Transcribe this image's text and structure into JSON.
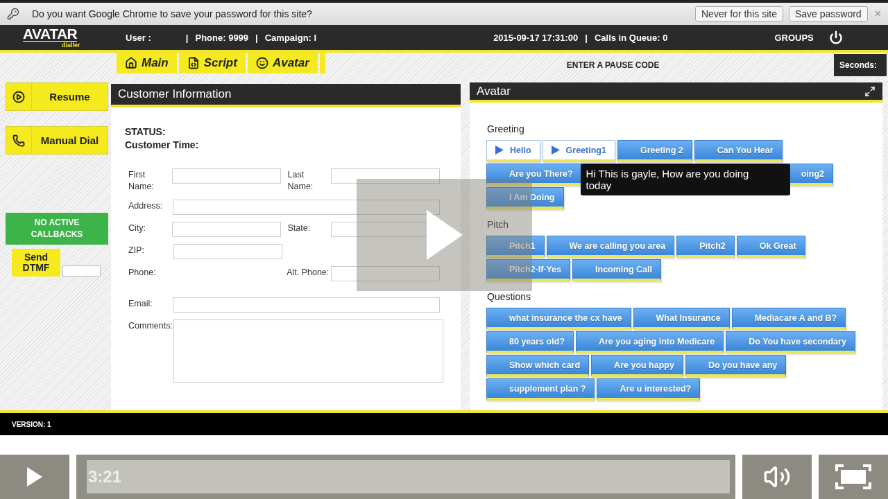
{
  "browser_bar": {
    "message": "Do you want Google Chrome to save your password for this site?",
    "buttons": [
      "Never for this site",
      "Save password"
    ],
    "close": "×"
  },
  "header": {
    "logo": "AVATAR",
    "tagline": "dialler",
    "left": [
      "User :",
      "|",
      "Phone: 9999",
      "|",
      "Campaign: l"
    ],
    "center": [
      "2015-09-17 17:31:00",
      "|",
      "Calls in Queue: 0"
    ],
    "groups": "GROUPS"
  },
  "tabs": [
    {
      "label": "Main"
    },
    {
      "label": "Script"
    },
    {
      "label": "Avatar"
    }
  ],
  "pause_code": "ENTER A PAUSE CODE",
  "seconds": "Seconds:",
  "sidebar": {
    "actions": [
      "Resume",
      "Manual Dial"
    ],
    "callbacks": "NO ACTIVE CALLBACKS",
    "dtmf": "Send DTMF"
  },
  "customer": {
    "title": "Customer Information",
    "status": "STATUS:",
    "time": "Customer Time:",
    "rows": [
      {
        "kind": "pair",
        "fields": [
          {
            "label": "First Name:",
            "input": true
          },
          {
            "label": "Last Name:",
            "input": true
          }
        ]
      },
      {
        "kind": "full",
        "fields": [
          {
            "label": "Address:",
            "input": true
          }
        ]
      },
      {
        "kind": "pair",
        "fields": [
          {
            "label": "City:",
            "input": true
          },
          {
            "label": "State:",
            "input": true
          }
        ]
      },
      {
        "kind": "pair",
        "fields": [
          {
            "label": "ZIP:",
            "input": true
          }
        ]
      },
      {
        "kind": "pair",
        "fields": [
          {
            "label": "Phone:",
            "input": false
          },
          {
            "label": "Alt. Phone:",
            "input": true
          }
        ]
      },
      {
        "kind": "full",
        "fields": [
          {
            "label": "Email:",
            "input": true
          }
        ]
      },
      {
        "kind": "area",
        "fields": [
          {
            "label": "Comments:",
            "input": true
          }
        ]
      }
    ]
  },
  "avatar": {
    "title": "Avatar",
    "sections": [
      {
        "title": "Greeting",
        "buttons": [
          {
            "label": "Hello",
            "kind": "playing"
          },
          {
            "label": "Greeting1",
            "kind": "playing",
            "tooltip": "Hi This is gayle, How are you doing today"
          },
          {
            "label": "Greeting 2",
            "kind": "normal"
          },
          {
            "label": "Can You Hear",
            "kind": "normal"
          },
          {
            "label": "Are you There?",
            "kind": "normal"
          },
          {
            "label": "oing2",
            "kind": "covered"
          },
          {
            "label": "I Am Doing",
            "kind": "normal"
          }
        ]
      },
      {
        "title": "Pitch",
        "buttons": [
          {
            "label": "Pitch1",
            "kind": "normal"
          },
          {
            "label": "We are calling you area",
            "kind": "normal"
          },
          {
            "label": "Pitch2",
            "kind": "normal"
          },
          {
            "label": "Ok Great",
            "kind": "normal"
          },
          {
            "label": "Pitch2-If-Yes",
            "kind": "normal"
          },
          {
            "label": "Incoming Call",
            "kind": "normal"
          }
        ]
      },
      {
        "title": "Questions",
        "buttons": [
          {
            "label": "what insurance the cx have",
            "kind": "normal"
          },
          {
            "label": "What Insurance",
            "kind": "normal"
          },
          {
            "label": "Mediacare A and B?",
            "kind": "normal"
          },
          {
            "label": "80 years old?",
            "kind": "normal"
          },
          {
            "label": "Are you aging into Medicare",
            "kind": "normal"
          },
          {
            "label": "Do You have secondary",
            "kind": "normal"
          },
          {
            "label": "Show which card",
            "kind": "normal"
          },
          {
            "label": "Are you happy",
            "kind": "normal"
          },
          {
            "label": "Do you have any",
            "kind": "normal"
          },
          {
            "label": "supplement plan ?",
            "kind": "normal"
          },
          {
            "label": "Are u interested?",
            "kind": "normal"
          }
        ]
      }
    ]
  },
  "footer": {
    "version": "VERSION: 1"
  },
  "player": {
    "time": "3:21"
  }
}
